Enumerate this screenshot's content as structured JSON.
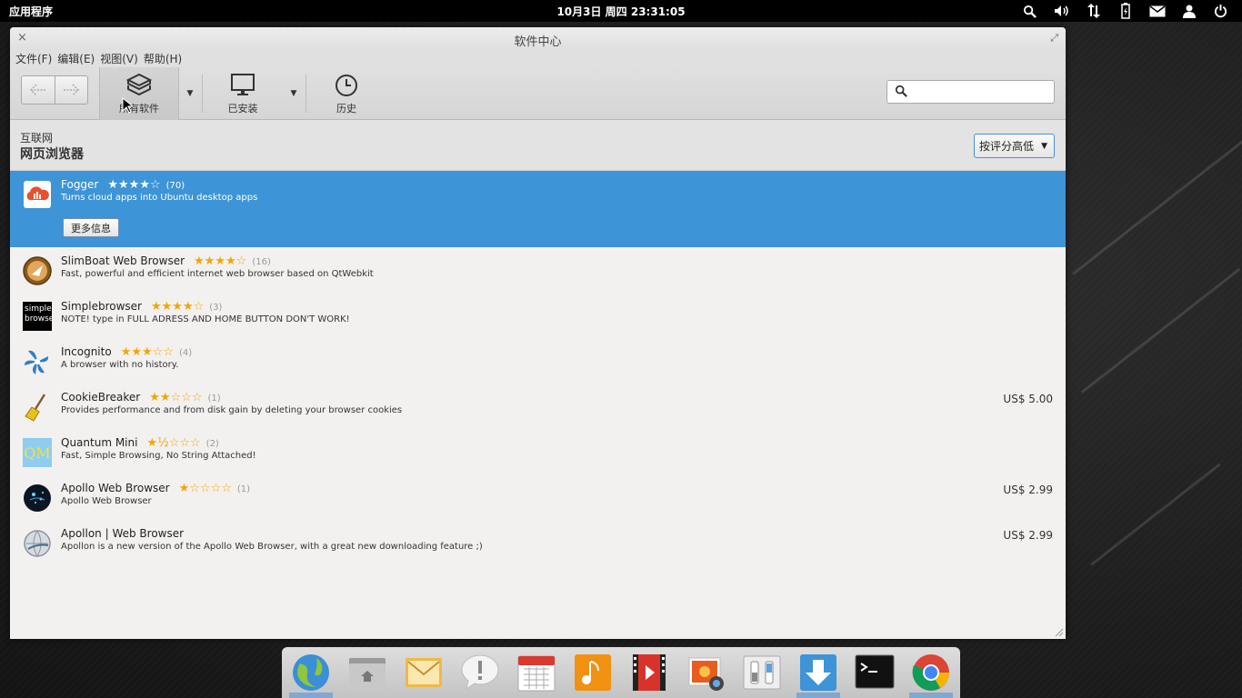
{
  "panel": {
    "apps_label": "应用程序",
    "clock": "10月3日 周四 23:31:05",
    "indicators": [
      "search-icon",
      "volume-icon",
      "network-icon",
      "battery-icon",
      "mail-icon",
      "user-icon",
      "power-icon"
    ]
  },
  "window": {
    "title": "软件中心",
    "close_glyph": "×",
    "maximize_glyph": "⤢"
  },
  "menubar": {
    "items": [
      "文件(F)",
      "编辑(E)",
      "视图(V)",
      "帮助(H)"
    ]
  },
  "toolbar": {
    "all_software_label": "所有软件",
    "installed_label": "已安装",
    "history_label": "历史",
    "search_placeholder": ""
  },
  "header": {
    "breadcrumb": "互联网",
    "category_title": "网页浏览器",
    "sort_label": "按评分高低"
  },
  "apps": [
    {
      "name": "Fogger",
      "stars": "★★★★☆",
      "count": "(70)",
      "desc": "Turns cloud apps into Ubuntu desktop apps",
      "price": "",
      "selected": true,
      "more_info": "更多信息"
    },
    {
      "name": "SlimBoat Web Browser",
      "stars": "★★★★☆",
      "count": "(16)",
      "desc": "Fast, powerful and efficient internet web browser based on QtWebkit",
      "price": ""
    },
    {
      "name": "Simplebrowser",
      "stars": "★★★★☆",
      "count": "(3)",
      "desc": "NOTE! type in FULL ADRESS AND HOME BUTTON DON'T WORK!",
      "price": ""
    },
    {
      "name": "Incognito",
      "stars": "★★★☆☆",
      "count": "(4)",
      "desc": "A browser with no history.",
      "price": ""
    },
    {
      "name": "CookieBreaker",
      "stars": "★★☆☆☆",
      "count": "(1)",
      "desc": "Provides performance and from disk gain by deleting your browser cookies",
      "price": "US$ 5.00"
    },
    {
      "name": "Quantum Mini",
      "stars": "★½☆☆☆",
      "count": "(2)",
      "desc": "Fast, Simple Browsing, No String Attached!",
      "price": ""
    },
    {
      "name": "Apollo Web Browser",
      "stars": "★☆☆☆☆",
      "count": "(1)",
      "desc": "Apollo Web Browser",
      "price": "US$ 2.99"
    },
    {
      "name": "Apollon | Web Browser",
      "stars": "",
      "count": "",
      "desc": "Apollon is a new version of the Apollo Web Browser, with a great new downloading feature ;)",
      "price": "US$ 2.99"
    }
  ],
  "icon_text": {
    "simplebrowser": "simple browse",
    "quantum": "QM"
  },
  "dock": {
    "items": [
      "browser-icon",
      "files-icon",
      "mail-icon",
      "notes-icon",
      "calendar-icon",
      "music-icon",
      "video-icon",
      "photos-icon",
      "settings-icon",
      "software-center-icon",
      "terminal-icon",
      "chrome-icon"
    ]
  },
  "colors": {
    "selection": "#3d94d6",
    "star": "#f5a500",
    "panel": "#000000"
  }
}
